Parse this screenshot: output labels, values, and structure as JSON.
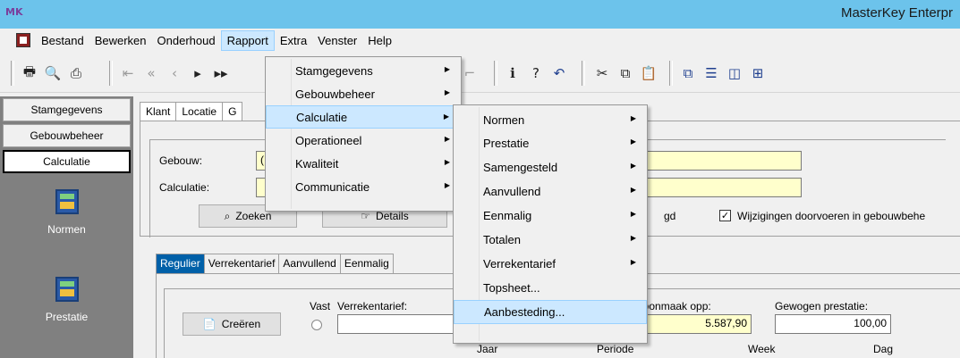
{
  "window": {
    "app_icon": "MK",
    "title": "MasterKey Enterpr"
  },
  "menubar": {
    "items": [
      "Bestand",
      "Bewerken",
      "Onderhoud",
      "Rapport",
      "Extra",
      "Venster",
      "Help"
    ],
    "active": "Rapport"
  },
  "toolbar": {
    "icons": [
      "printer-icon",
      "print-preview-icon",
      "page-setup-icon",
      "first-record-icon",
      "prev-page-icon",
      "prev-record-icon",
      "next-record-icon",
      "next-page-icon",
      "filter-icon",
      "info-icon",
      "help-icon",
      "undo-icon",
      "cut-icon",
      "copy-icon",
      "paste-icon",
      "tile-cascade-icon",
      "tile-horizontal-icon",
      "tile-vertical-icon",
      "arrange-icon"
    ]
  },
  "leftnav": {
    "buttons": [
      "Stamgegevens",
      "Gebouwbeheer",
      "Calculatie"
    ],
    "active": "Calculatie",
    "tiles": [
      {
        "label": "Normen",
        "icon": "normen-icon"
      },
      {
        "label": "Prestatie",
        "icon": "prestatie-icon"
      }
    ]
  },
  "main": {
    "top_tabs": [
      "Klant",
      "Locatie",
      "G"
    ],
    "gebouw_label": "Gebouw:",
    "gebouw_value": "(",
    "calculatie_label": "Calculatie:",
    "calculatie_value": "",
    "zoeken_label": "Zoeken",
    "details_label": "Details",
    "truncated_text": "gd",
    "sync_checkbox_label": "Wijzigingen doorvoeren in gebouwbehe",
    "sync_checked": true,
    "bottom_tabs": [
      "Regulier",
      "Verrekentarief",
      "Aanvullend",
      "Eenmalig"
    ],
    "active_bottom_tab": "Regulier",
    "creeren_label": "Creëren",
    "vast_label": "Vast",
    "verrekentarief_label": "Verrekentarief:",
    "schoonmaak_label": "Schoonmaak opp:",
    "schoonmaak_value": "5.587,90",
    "gewogen_label": "Gewogen prestatie:",
    "gewogen_value": "100,00",
    "period_headers": [
      "Jaar",
      "Periode",
      "Week",
      "Dag"
    ]
  },
  "rapport_menu": {
    "items": [
      "Stamgegevens",
      "Gebouwbeheer",
      "Calculatie",
      "Operationeel",
      "Kwaliteit",
      "Communicatie"
    ],
    "highlighted": "Calculatie"
  },
  "calculatie_submenu": {
    "items": [
      "Normen",
      "Prestatie",
      "Samengesteld",
      "Aanvullend",
      "Eenmalig",
      "Totalen",
      "Verrekentarief",
      "Topsheet...",
      "Aanbesteding..."
    ],
    "with_arrow": [
      true,
      true,
      true,
      true,
      true,
      true,
      true,
      false,
      false
    ],
    "highlighted": "Aanbesteding..."
  }
}
